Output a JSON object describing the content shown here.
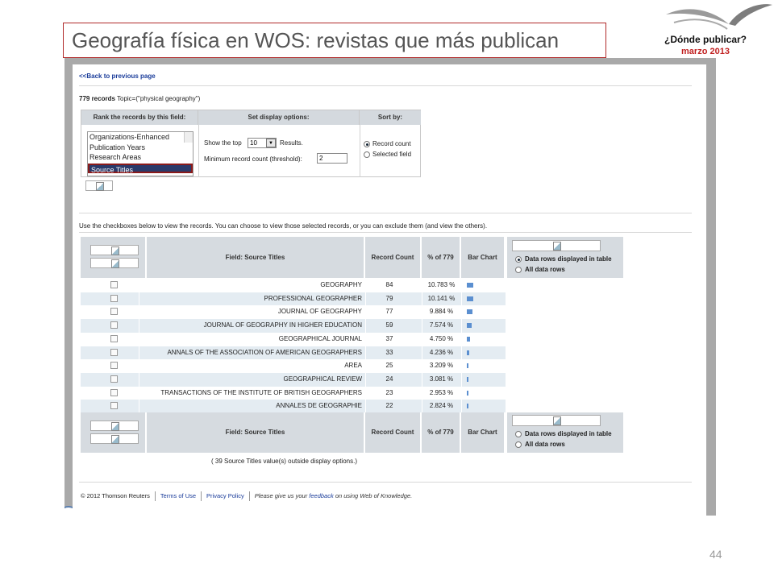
{
  "slide": {
    "title": "Geografía física en WOS: revistas que más publican",
    "brand_question": "¿Dónde publicar?",
    "brand_date": "marzo 2013",
    "page_number": "44"
  },
  "screen": {
    "back_link": "<<Back to previous page",
    "records_count": "779 records",
    "records_topic": "Topic=(\"physical geography\")",
    "options": {
      "rank_header": "Rank the records by this field:",
      "display_header": "Set display options:",
      "sort_header": "Sort by:",
      "rank_items": [
        "Organizations-Enhanced",
        "Publication Years",
        "Research Areas",
        "Source Titles"
      ],
      "show_top_prefix": "Show the top",
      "show_top_value": "10",
      "show_top_suffix": "Results.",
      "min_count_label": "Minimum record count (threshold):",
      "min_count_value": "2",
      "sort_record_count": "Record count",
      "sort_selected_field": "Selected field"
    },
    "checkbox_note": "Use the checkboxes below to view the records. You can choose to view those selected records, or you can exclude them (and view the others).",
    "table": {
      "field_header": "Field: Source Titles",
      "count_header": "Record Count",
      "pct_header": "% of 779",
      "bar_header": "Bar Chart",
      "display_rows_option": "Data rows displayed in table",
      "all_rows_option": "All data rows",
      "rows": [
        {
          "title": "GEOGRAPHY",
          "count": "84",
          "pct": "10.783 %",
          "frac": 0.10783
        },
        {
          "title": "PROFESSIONAL GEOGRAPHER",
          "count": "79",
          "pct": "10.141 %",
          "frac": 0.10141
        },
        {
          "title": "JOURNAL OF GEOGRAPHY",
          "count": "77",
          "pct": "9.884 %",
          "frac": 0.09884
        },
        {
          "title": "JOURNAL OF GEOGRAPHY IN HIGHER EDUCATION",
          "count": "59",
          "pct": "7.574 %",
          "frac": 0.07574
        },
        {
          "title": "GEOGRAPHICAL JOURNAL",
          "count": "37",
          "pct": "4.750 %",
          "frac": 0.0475
        },
        {
          "title": "ANNALS OF THE ASSOCIATION OF AMERICAN GEOGRAPHERS",
          "count": "33",
          "pct": "4.236 %",
          "frac": 0.04236
        },
        {
          "title": "AREA",
          "count": "25",
          "pct": "3.209 %",
          "frac": 0.03209
        },
        {
          "title": "GEOGRAPHICAL REVIEW",
          "count": "24",
          "pct": "3.081 %",
          "frac": 0.03081
        },
        {
          "title": "TRANSACTIONS OF THE INSTITUTE OF BRITISH GEOGRAPHERS",
          "count": "23",
          "pct": "2.953 %",
          "frac": 0.02953
        },
        {
          "title": "ANNALES DE GEOGRAPHIE",
          "count": "22",
          "pct": "2.824 %",
          "frac": 0.02824
        }
      ],
      "outside_note": "( 39 Source Titles value(s) outside display options.)"
    },
    "footer": {
      "copyright": "© 2012 Thomson Reuters",
      "terms": "Terms of Use",
      "privacy": "Privacy Policy",
      "feedback_prefix": "Please give us your",
      "feedback_link": "feedback",
      "feedback_suffix": "on using Web of Knowledge."
    },
    "colors": {
      "bar": "#5b8fd0",
      "header": "#d6dbe0",
      "row_alt": "#e4ecf2",
      "title_border": "#b02a2a"
    }
  }
}
